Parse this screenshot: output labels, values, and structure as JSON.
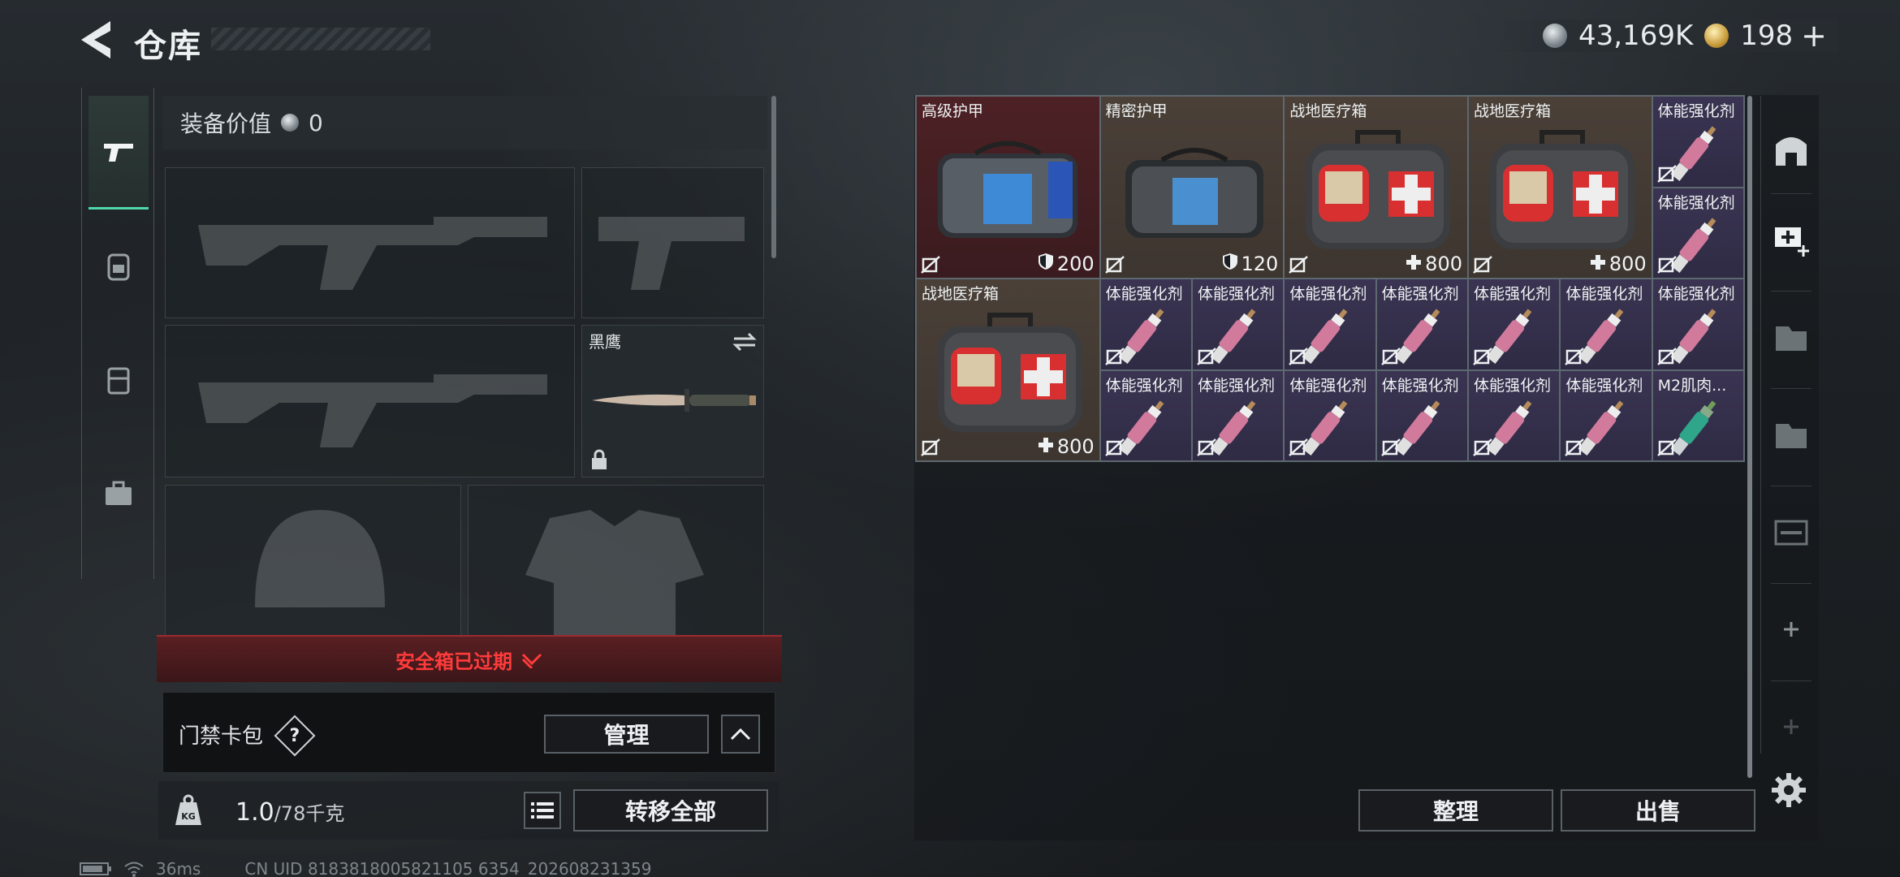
{
  "header": {
    "title": "仓库",
    "currency": [
      {
        "icon": "silver-coin-icon",
        "value": "43,169K"
      },
      {
        "icon": "gold-coin-icon",
        "value": "198"
      }
    ],
    "add_symbol": "+"
  },
  "left_nav": {
    "tabs": [
      {
        "icon": "pistol-icon",
        "active": true
      },
      {
        "icon": "backpack-icon",
        "active": false
      },
      {
        "icon": "vest-icon",
        "active": false
      },
      {
        "icon": "briefcase-icon",
        "active": false
      }
    ]
  },
  "loadout": {
    "equip_value_label": "装备价值",
    "equip_value": "0",
    "slots": {
      "primary1": "",
      "secondary": "",
      "primary2": "",
      "melee": {
        "label": "黑鹰",
        "locked": true
      },
      "helmet": "",
      "armor": ""
    }
  },
  "safe_box": {
    "status": "安全箱已过期"
  },
  "card_bag": {
    "label": "门禁卡包",
    "help": "?",
    "manage_label": "管理"
  },
  "weight": {
    "current": "1.0",
    "max": "/78千克",
    "icon_label": "KG"
  },
  "actions": {
    "transfer_all": "转移全部",
    "sort": "整理",
    "sell": "出售"
  },
  "inventory": {
    "items": [
      {
        "name": "高级护甲",
        "value": "200",
        "value_icon": "shield-icon",
        "type": "armor",
        "rarity": "red"
      },
      {
        "name": "精密护甲",
        "value": "120",
        "value_icon": "shield-icon",
        "type": "armor2",
        "rarity": "brown"
      },
      {
        "name": "战地医疗箱",
        "value": "800",
        "value_icon": "cross-icon",
        "type": "medkit",
        "rarity": "brown"
      },
      {
        "name": "战地医疗箱",
        "value": "800",
        "value_icon": "cross-icon",
        "type": "medkit",
        "rarity": "brown"
      },
      {
        "name": "体能强化剂",
        "type": "injector",
        "rarity": "purple"
      },
      {
        "name": "体能强化剂",
        "type": "injector",
        "rarity": "purple"
      },
      {
        "name": "战地医疗箱",
        "value": "800",
        "value_icon": "cross-icon",
        "type": "medkit",
        "rarity": "brown"
      },
      {
        "name": "体能强化剂",
        "type": "injector",
        "rarity": "purple"
      },
      {
        "name": "体能强化剂",
        "type": "injector",
        "rarity": "purple"
      },
      {
        "name": "体能强化剂",
        "type": "injector",
        "rarity": "purple"
      },
      {
        "name": "体能强化剂",
        "type": "injector",
        "rarity": "purple"
      },
      {
        "name": "体能强化剂",
        "type": "injector",
        "rarity": "purple"
      },
      {
        "name": "体能强化剂",
        "type": "injector",
        "rarity": "purple"
      },
      {
        "name": "体能强化剂",
        "type": "injector",
        "rarity": "purple"
      },
      {
        "name": "体能强化剂",
        "type": "injector",
        "rarity": "purple"
      },
      {
        "name": "体能强化剂",
        "type": "injector",
        "rarity": "purple"
      },
      {
        "name": "体能强化剂",
        "type": "injector",
        "rarity": "purple"
      },
      {
        "name": "体能强化剂",
        "type": "injector",
        "rarity": "purple"
      },
      {
        "name": "体能强化剂",
        "type": "injector",
        "rarity": "purple"
      },
      {
        "name": "体能强化剂",
        "type": "injector",
        "rarity": "purple"
      },
      {
        "name": "M2肌肉...",
        "type": "injector-green",
        "rarity": "purple"
      }
    ]
  },
  "right_nav": {
    "tabs": [
      "vault-icon",
      "medkit-add-icon",
      "storage-icon",
      "storage2-icon",
      "weapon-storage-icon",
      "plus-icon",
      "plus-disabled-icon"
    ]
  },
  "status_bar": {
    "ping": "36ms",
    "uid": "CN UID 8183818005821105 6354_202608231359"
  }
}
